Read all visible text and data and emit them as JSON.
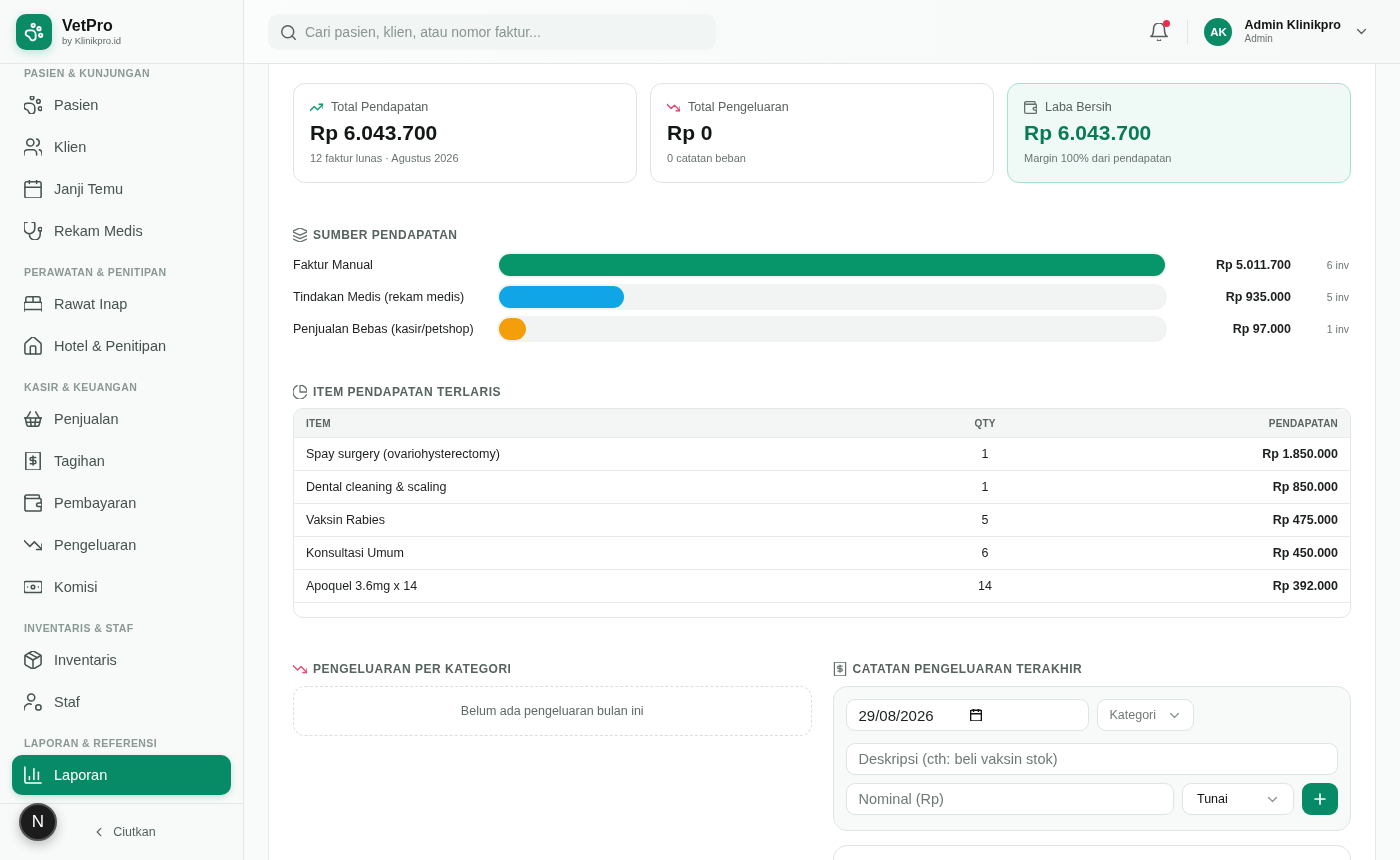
{
  "sidebar": {
    "brand": {
      "name": "VetPro",
      "tagline": "by Klinikpro.id"
    },
    "groups": [
      {
        "label": "PASIEN & KUNJUNGAN",
        "items": [
          {
            "label": "Pasien",
            "selected": false
          },
          {
            "label": "Klien",
            "selected": false
          },
          {
            "label": "Janji Temu",
            "selected": false
          },
          {
            "label": "Rekam Medis",
            "selected": false
          }
        ]
      },
      {
        "label": "PERAWATAN & PENITIPAN",
        "items": [
          {
            "label": "Rawat Inap",
            "selected": false
          },
          {
            "label": "Hotel & Penitipan",
            "selected": false
          }
        ]
      },
      {
        "label": "KASIR & KEUANGAN",
        "items": [
          {
            "label": "Penjualan",
            "selected": false
          },
          {
            "label": "Tagihan",
            "selected": false
          },
          {
            "label": "Pembayaran",
            "selected": false
          },
          {
            "label": "Pengeluaran",
            "selected": false
          },
          {
            "label": "Komisi",
            "selected": false
          }
        ]
      },
      {
        "label": "INVENTARIS & STAF",
        "items": [
          {
            "label": "Inventaris",
            "selected": false
          },
          {
            "label": "Staf",
            "selected": false
          }
        ]
      },
      {
        "label": "LAPORAN & REFERENSI",
        "items": [
          {
            "label": "Laporan",
            "selected": true
          }
        ]
      }
    ],
    "collapse_button": {
      "label": "Ciutkan"
    }
  },
  "dev_badge": {
    "label": "N"
  },
  "header": {
    "search": {
      "placeholder": "Cari pasien, klien, atau nomor faktur..."
    },
    "notifications": {
      "unread": true
    },
    "user": {
      "initials": "AK",
      "name": "Admin Klinikpro",
      "role": "Admin"
    }
  },
  "summary_cards": [
    {
      "kind": "income",
      "label": "Total Pendapatan",
      "value": "Rp 6.043.700",
      "note": "12 faktur lunas · Agustus 2026"
    },
    {
      "kind": "expense",
      "label": "Total Pengeluaran",
      "value": "Rp 0",
      "note": "0 catatan beban"
    },
    {
      "kind": "profit",
      "label": "Laba Bersih",
      "value": "Rp 6.043.700",
      "note": "Margin 100% dari pendapatan"
    }
  ],
  "revenue_sources": {
    "title": "SUMBER PENDAPATAN",
    "rows": [
      {
        "label": "Faktur Manual",
        "level": 1,
        "color": "#079669",
        "amount": "Rp 5.011.700",
        "count": "6 inv"
      },
      {
        "label": "Tindakan Medis (rekam medis)",
        "level": 0.187,
        "color": "#10a5e6",
        "amount": "Rp 935.000",
        "count": "5 inv"
      },
      {
        "label": "Penjualan Bebas (kasir/petshop)",
        "level": 0.04,
        "color": "#f59e0b",
        "amount": "Rp 97.000",
        "count": "1 inv"
      }
    ]
  },
  "top_items": {
    "title": "ITEM PENDAPATAN TERLARIS",
    "columns": [
      "ITEM",
      "QTY",
      "PENDAPATAN"
    ],
    "rows": [
      {
        "item": "Spay surgery (ovariohysterectomy)",
        "qty": "1",
        "revenue": "Rp 1.850.000"
      },
      {
        "item": "Dental cleaning & scaling",
        "qty": "1",
        "revenue": "Rp 850.000"
      },
      {
        "item": "Vaksin Rabies",
        "qty": "5",
        "revenue": "Rp 475.000"
      },
      {
        "item": "Konsultasi Umum",
        "qty": "6",
        "revenue": "Rp 450.000"
      },
      {
        "item": "Apoquel 3.6mg x 14",
        "qty": "14",
        "revenue": "Rp 392.000"
      }
    ]
  },
  "expenses_by_category": {
    "title": "PENGELUARAN PER KATEGORI",
    "empty_text": "Belum ada pengeluaran bulan ini"
  },
  "recent_expenses": {
    "title": "CATATAN PENGELUARAN TERAKHIR",
    "form": {
      "date": {
        "value": "29/08/2026"
      },
      "category": {
        "placeholder": "Kategori"
      },
      "description": {
        "placeholder": "Deskripsi (cth: beli vaksin stok)"
      },
      "amount": {
        "placeholder": "Nominal (Rp)"
      },
      "payment_method": {
        "value": "Tunai"
      }
    }
  }
}
